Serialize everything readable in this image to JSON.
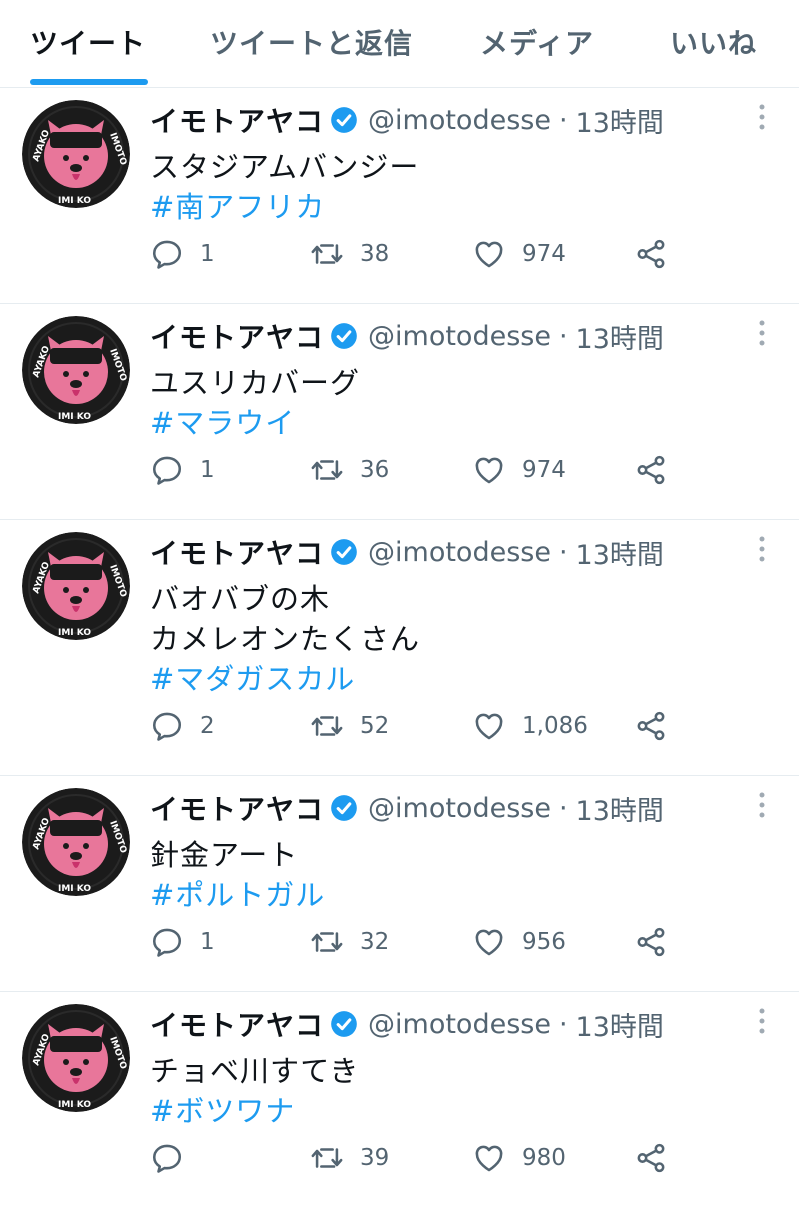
{
  "tabs": [
    {
      "label": "ツイート",
      "active": true
    },
    {
      "label": "ツイートと返信",
      "active": false
    },
    {
      "label": "メディア",
      "active": false
    },
    {
      "label": "いいね",
      "active": false
    }
  ],
  "colors": {
    "accent": "#1d9bf0",
    "text": "#0f1419",
    "muted": "#536471",
    "divider": "#e6ecf0",
    "avatar_pink": "#e8769a"
  },
  "avatar": {
    "ring_text_left": "AYAKO",
    "ring_text_right": "IMOTO",
    "ring_text_bottom": "IMI KO"
  },
  "tweets": [
    {
      "name": "イモトアヤコ",
      "handle": "@imotodesse",
      "dot": "·",
      "time": "13時間",
      "lines": [
        "スタジアムバンジー"
      ],
      "hashtag": "#南アフリカ",
      "replies": "1",
      "retweets": "38",
      "likes": "974"
    },
    {
      "name": "イモトアヤコ",
      "handle": "@imotodesse",
      "dot": "·",
      "time": "13時間",
      "lines": [
        "ユスリカバーグ"
      ],
      "hashtag": "#マラウイ",
      "replies": "1",
      "retweets": "36",
      "likes": "974"
    },
    {
      "name": "イモトアヤコ",
      "handle": "@imotodesse",
      "dot": "·",
      "time": "13時間",
      "lines": [
        "バオバブの木",
        "カメレオンたくさん"
      ],
      "hashtag": "#マダガスカル",
      "replies": "2",
      "retweets": "52",
      "likes": "1,086"
    },
    {
      "name": "イモトアヤコ",
      "handle": "@imotodesse",
      "dot": "·",
      "time": "13時間",
      "lines": [
        "針金アート"
      ],
      "hashtag": "#ポルトガル",
      "replies": "1",
      "retweets": "32",
      "likes": "956"
    },
    {
      "name": "イモトアヤコ",
      "handle": "@imotodesse",
      "dot": "·",
      "time": "13時間",
      "lines": [
        "チョベ川すてき"
      ],
      "hashtag": "#ボツワナ",
      "replies": "",
      "retweets": "39",
      "likes": "980"
    }
  ]
}
